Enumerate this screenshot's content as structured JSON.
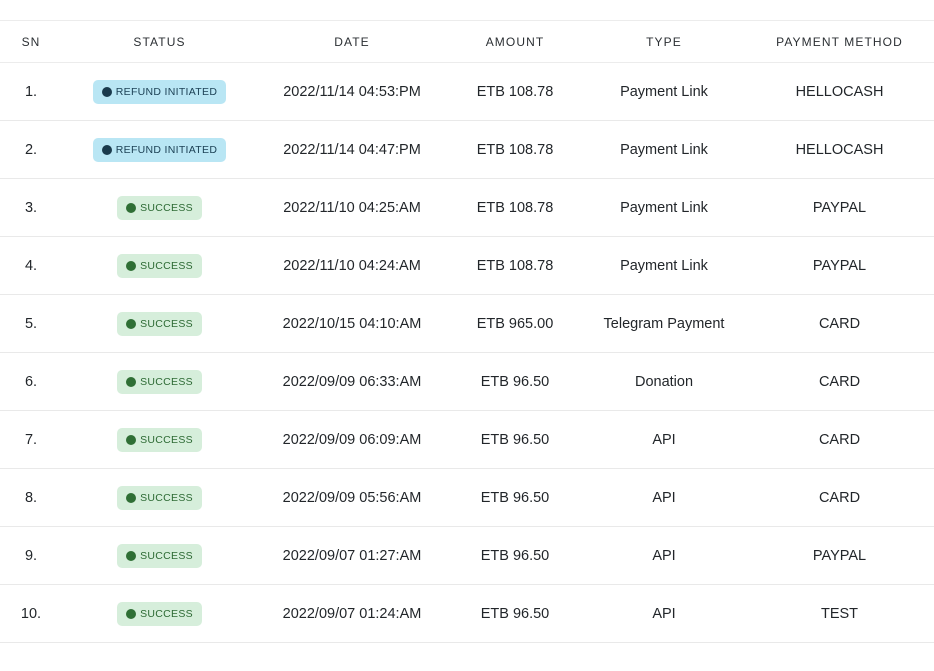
{
  "table": {
    "headers": {
      "sn": "SN",
      "status": "STATUS",
      "date": "DATE",
      "amount": "AMOUNT",
      "type": "TYPE",
      "payment_method": "PAYMENT METHOD"
    },
    "rows": [
      {
        "sn": "1.",
        "status": "REFUND INITIATED",
        "status_kind": "refund",
        "date": "2022/11/14 04:53:PM",
        "amount": "ETB 108.78",
        "type": "Payment Link",
        "payment_method": "HELLOCASH"
      },
      {
        "sn": "2.",
        "status": "REFUND INITIATED",
        "status_kind": "refund",
        "date": "2022/11/14 04:47:PM",
        "amount": "ETB 108.78",
        "type": "Payment Link",
        "payment_method": "HELLOCASH"
      },
      {
        "sn": "3.",
        "status": "SUCCESS",
        "status_kind": "success",
        "date": "2022/11/10 04:25:AM",
        "amount": "ETB 108.78",
        "type": "Payment Link",
        "payment_method": "PAYPAL"
      },
      {
        "sn": "4.",
        "status": "SUCCESS",
        "status_kind": "success",
        "date": "2022/11/10 04:24:AM",
        "amount": "ETB 108.78",
        "type": "Payment Link",
        "payment_method": "PAYPAL"
      },
      {
        "sn": "5.",
        "status": "SUCCESS",
        "status_kind": "success",
        "date": "2022/10/15 04:10:AM",
        "amount": "ETB 965.00",
        "type": "Telegram Payment",
        "payment_method": "CARD"
      },
      {
        "sn": "6.",
        "status": "SUCCESS",
        "status_kind": "success",
        "date": "2022/09/09 06:33:AM",
        "amount": "ETB 96.50",
        "type": "Donation",
        "payment_method": "CARD"
      },
      {
        "sn": "7.",
        "status": "SUCCESS",
        "status_kind": "success",
        "date": "2022/09/09 06:09:AM",
        "amount": "ETB 96.50",
        "type": "API",
        "payment_method": "CARD"
      },
      {
        "sn": "8.",
        "status": "SUCCESS",
        "status_kind": "success",
        "date": "2022/09/09 05:56:AM",
        "amount": "ETB 96.50",
        "type": "API",
        "payment_method": "CARD"
      },
      {
        "sn": "9.",
        "status": "SUCCESS",
        "status_kind": "success",
        "date": "2022/09/07 01:27:AM",
        "amount": "ETB 96.50",
        "type": "API",
        "payment_method": "PAYPAL"
      },
      {
        "sn": "10.",
        "status": "SUCCESS",
        "status_kind": "success",
        "date": "2022/09/07 01:24:AM",
        "amount": "ETB 96.50",
        "type": "API",
        "payment_method": "TEST"
      }
    ]
  },
  "colors": {
    "refund_badge_bg": "#b9e6f4",
    "refund_badge_text": "#1d4256",
    "success_badge_bg": "#d6eedb",
    "success_badge_text": "#2d6a34"
  }
}
